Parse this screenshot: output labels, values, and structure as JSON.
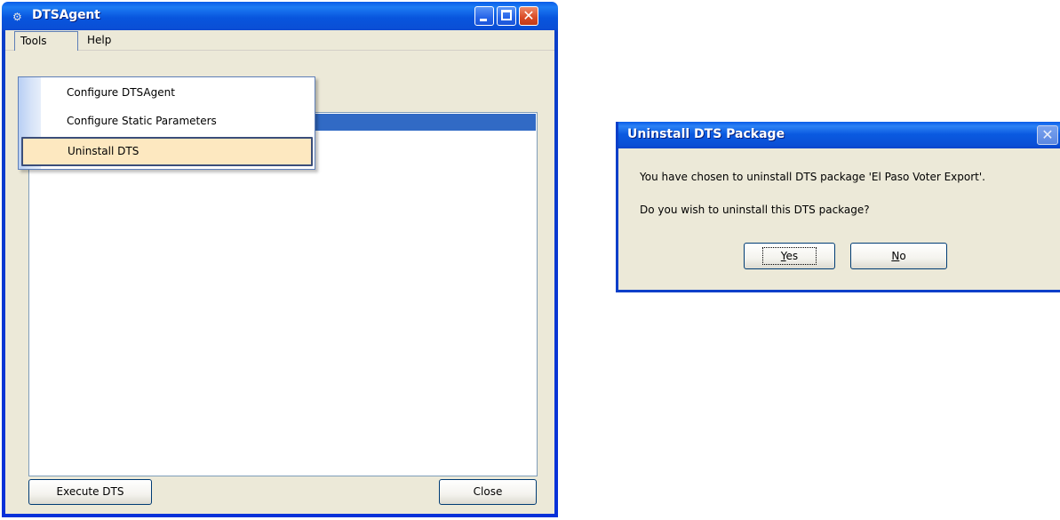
{
  "main_window": {
    "title": "DTSAgent",
    "menu": {
      "tools": "Tools",
      "help": "Help"
    },
    "tools_menu_items": [
      "Configure DTSAgent",
      "Configure Static Parameters",
      "Uninstall DTS"
    ],
    "buttons": {
      "execute": "Execute DTS",
      "close": "Close"
    }
  },
  "dialog": {
    "title": "Uninstall DTS Package",
    "message_line1": "You have chosen to uninstall DTS package 'El Paso Voter Export'.",
    "message_line2": "Do you wish to uninstall this DTS package?",
    "yes_mnemonic": "Y",
    "yes_rest": "es",
    "no_mnemonic": "N",
    "no_rest": "o",
    "close_glyph": "✕"
  },
  "icons": {
    "app": "gears-icon",
    "minimize": "minimize-icon",
    "maximize": "maximize-icon",
    "close": "close-icon"
  },
  "colors": {
    "titlebar_blue": "#0a4fd6",
    "selection_blue": "#316ac5",
    "menu_highlight": "#fde8c0",
    "window_face": "#ece9d8"
  }
}
